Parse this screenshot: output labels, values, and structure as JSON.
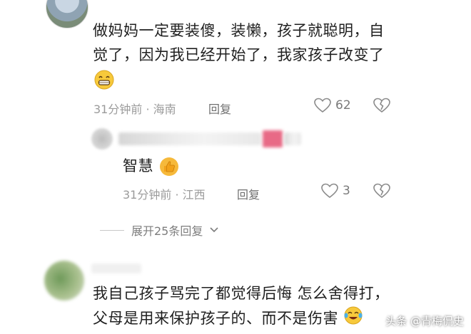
{
  "comment1": {
    "text_line1": "做妈妈一定要装傻，装懒，孩子就聪明，自",
    "text_line2": "觉了，因为我已经开始了，我家孩子改变了",
    "emoji": "grinning-face",
    "time": "31分钟前 · 海南",
    "reply_label": "回复",
    "like_count": "62"
  },
  "reply1": {
    "text": "智慧",
    "emoji": "thumbs-up",
    "time": "31分钟前 · 江西",
    "reply_label": "回复",
    "like_count": "3"
  },
  "expand_replies": {
    "label": "展开25条回复"
  },
  "comment2": {
    "text_line1": "我自己孩子骂完了都觉得后悔 怎么舍得打，",
    "text_line2": "父母是用来保护孩子的、而不是伤害",
    "emoji": "crying-laughing"
  },
  "watermark": {
    "text": "头条 @青梅侃史"
  },
  "colors": {
    "text": "#1f1f1f",
    "meta": "#9b9b9b",
    "blur_accent": "#e86a86"
  }
}
